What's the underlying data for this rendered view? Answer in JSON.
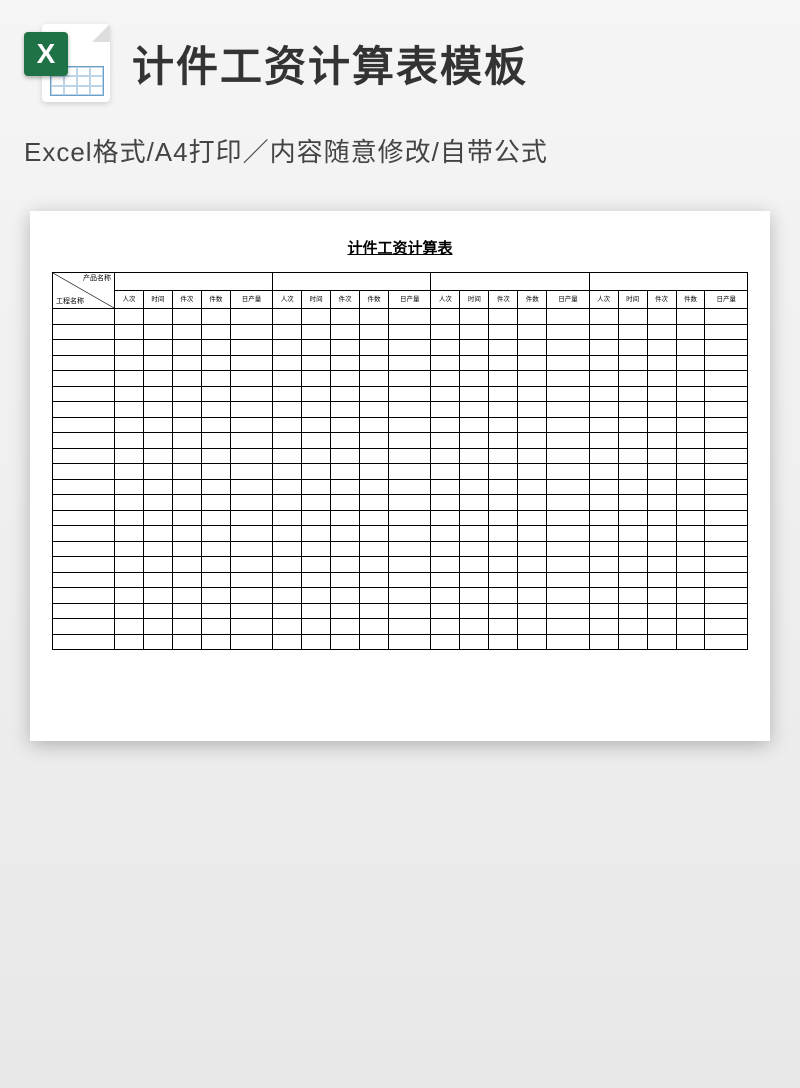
{
  "header": {
    "title": "计件工资计算表模板",
    "icon_letter": "X"
  },
  "subtitle": "Excel格式/A4打印／内容随意修改/自带公式",
  "sheet": {
    "title": "计件工资计算表",
    "diag": {
      "top": "产品名称",
      "bottom": "工程名称"
    },
    "group_columns": [
      "人次",
      "时间",
      "件次",
      "件数",
      "日产量"
    ],
    "group_count": 4,
    "body_rows": 22
  }
}
